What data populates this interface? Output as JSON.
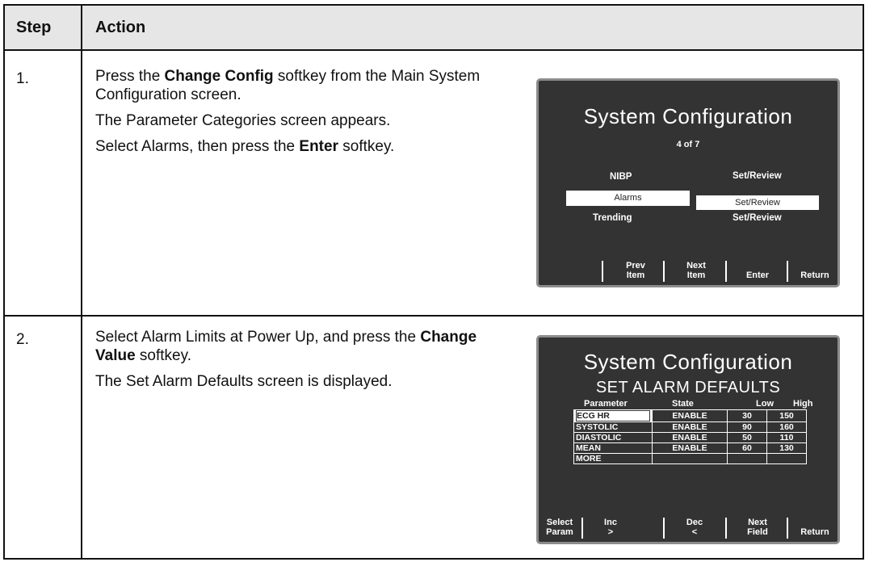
{
  "table": {
    "header": {
      "step": "Step",
      "action": "Action"
    },
    "rows": [
      {
        "step": "1.",
        "lines": [
          {
            "pre": "Press the ",
            "bold": "Change Config",
            "post": " softkey from the Main System Configuration screen."
          },
          {
            "pre": "The Parameter Categories screen appears.",
            "bold": "",
            "post": ""
          },
          {
            "pre": "Select Alarms, then press the ",
            "bold": "Enter",
            "post": " softkey."
          }
        ]
      },
      {
        "step": "2.",
        "lines": [
          {
            "pre": "Select Alarm Limits at Power Up, and press the ",
            "bold": "Change Value",
            "post": " softkey."
          },
          {
            "pre": "The Set Alarm Defaults screen is displayed.",
            "bold": "",
            "post": ""
          }
        ]
      }
    ]
  },
  "screen1": {
    "title": "System Configuration",
    "page": "4 of 7",
    "items": [
      {
        "name": "NIBP",
        "value": "Set/Review",
        "selected": false
      },
      {
        "name": "Alarms",
        "value": "Set/Review",
        "selected": true
      },
      {
        "name": "Trending",
        "value": "Set/Review",
        "selected": false
      }
    ],
    "softkeys": [
      {
        "line1": "Prev",
        "line2": "Item"
      },
      {
        "line1": "Next",
        "line2": "Item"
      },
      {
        "line1": "",
        "line2": "Enter"
      },
      {
        "line1": "",
        "line2": "Return"
      }
    ]
  },
  "screen2": {
    "title": "System Configuration",
    "subtitle": "SET ALARM DEFAULTS",
    "columns": [
      "Parameter",
      "State",
      "Low",
      "High"
    ],
    "rows": [
      [
        "ECG HR",
        "ENABLE",
        "30",
        "150"
      ],
      [
        "SYSTOLIC",
        "ENABLE",
        "90",
        "160"
      ],
      [
        "DIASTOLIC",
        "ENABLE",
        "50",
        "110"
      ],
      [
        "MEAN",
        "ENABLE",
        "60",
        "130"
      ],
      [
        "MORE",
        "",
        "",
        ""
      ]
    ],
    "softkeys": [
      {
        "line1": "Select",
        "line2": "Param"
      },
      {
        "line1": "Inc",
        "line2": ">"
      },
      {
        "line1": "Dec",
        "line2": "<"
      },
      {
        "line1": "Next",
        "line2": "Field"
      },
      {
        "line1": "",
        "line2": "Return"
      }
    ]
  },
  "colors": {
    "screen_bg": "#333333",
    "screen_border": "#8c8c8c",
    "header_bg": "#e6e6e6"
  }
}
